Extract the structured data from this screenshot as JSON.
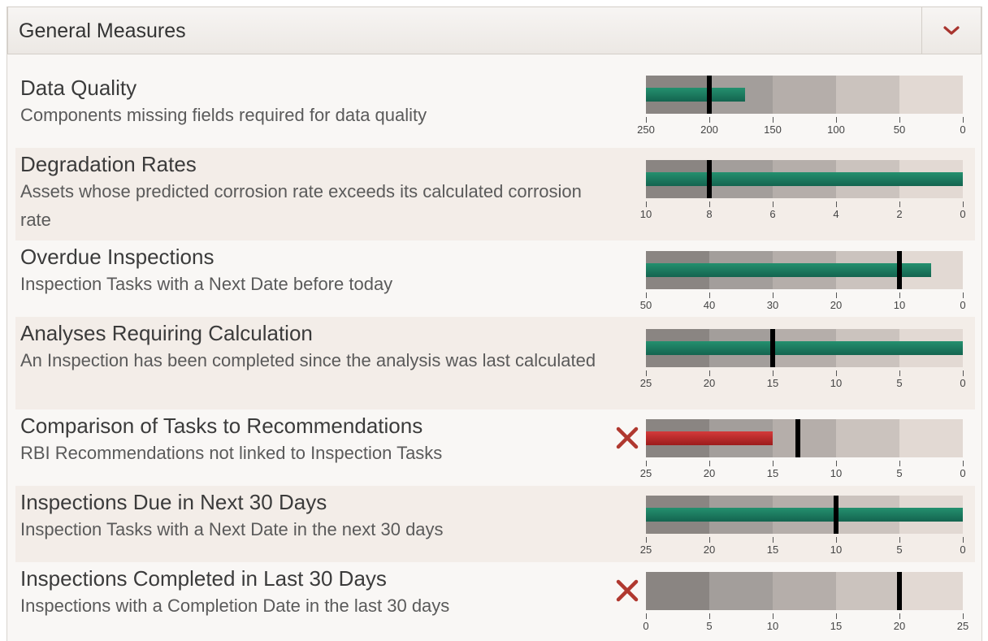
{
  "panel": {
    "title": "General Measures",
    "collapse_icon": "chevron-down-icon",
    "accent_color": "#a8342e"
  },
  "measures": [
    {
      "title": "Data Quality",
      "description": "Components missing fields required for data quality",
      "status": "ok",
      "scale": [
        250,
        200,
        150,
        100,
        50,
        0
      ],
      "actual": 172,
      "target": 200
    },
    {
      "title": "Degradation Rates",
      "description": "Assets whose predicted corrosion rate exceeds its calculated corrosion rate",
      "status": "ok",
      "scale": [
        10,
        8,
        6,
        4,
        2,
        0
      ],
      "actual": 0,
      "target": 8
    },
    {
      "title": "Overdue Inspections",
      "description": "Inspection Tasks with a Next Date before today",
      "status": "ok",
      "scale": [
        50,
        40,
        30,
        20,
        10,
        0
      ],
      "actual": 5,
      "target": 10
    },
    {
      "title": "Analyses Requiring Calculation",
      "description": "An Inspection has been completed since the analysis was last calculated",
      "status": "ok",
      "scale": [
        25,
        20,
        15,
        10,
        5,
        0
      ],
      "actual": 0,
      "target": 15
    },
    {
      "title": "Comparison of Tasks to Recommendations",
      "description": "RBI Recommendations not linked to Inspection Tasks",
      "status": "fail",
      "scale": [
        25,
        20,
        15,
        10,
        5,
        0
      ],
      "actual": 15,
      "target": 13
    },
    {
      "title": "Inspections Due in Next 30 Days",
      "description": "Inspection Tasks with a Next Date in the next 30 days",
      "status": "ok",
      "scale": [
        25,
        20,
        15,
        10,
        5,
        0
      ],
      "actual": 0,
      "target": 10
    },
    {
      "title": "Inspections Completed in Last 30 Days",
      "description": "Inspections with a Completion Date in the last 30 days",
      "status": "fail",
      "scale": [
        0,
        5,
        10,
        15,
        20,
        25
      ],
      "actual": 0,
      "target": 20
    }
  ]
}
